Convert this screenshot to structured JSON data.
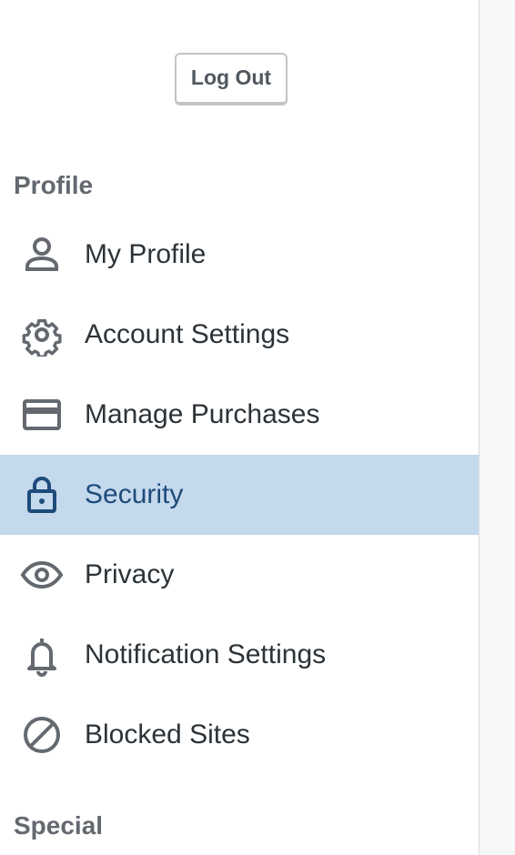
{
  "logout_button": {
    "label": "Log Out"
  },
  "sections": {
    "profile": "Profile",
    "special": "Special"
  },
  "nav": {
    "items": [
      {
        "label": "My Profile",
        "icon": "user-icon",
        "selected": false
      },
      {
        "label": "Account Settings",
        "icon": "gear-icon",
        "selected": false
      },
      {
        "label": "Manage Purchases",
        "icon": "credit-card-icon",
        "selected": false
      },
      {
        "label": "Security",
        "icon": "lock-icon",
        "selected": true
      },
      {
        "label": "Privacy",
        "icon": "eye-icon",
        "selected": false
      },
      {
        "label": "Notification Settings",
        "icon": "bell-icon",
        "selected": false
      },
      {
        "label": "Blocked Sites",
        "icon": "blocked-icon",
        "selected": false
      }
    ]
  },
  "colors": {
    "selected_background": "#c5d9ed",
    "selected_text": "#1d4b7a",
    "text": "#2c3338",
    "icon": "#646970",
    "heading": "#646970"
  }
}
